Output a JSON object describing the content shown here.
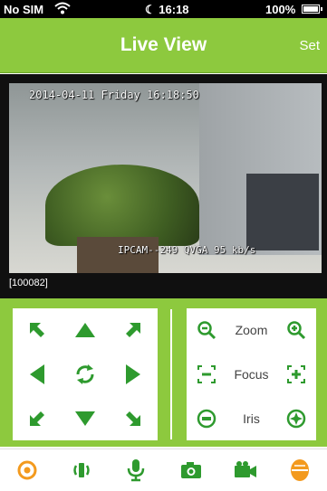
{
  "status_bar": {
    "carrier": "No SIM",
    "time": "16:18",
    "battery": "100%"
  },
  "nav": {
    "title": "Live View",
    "set_label": "Set"
  },
  "video": {
    "osd_date": "2014-04-11 Friday 16:18:50",
    "osd_info": "IPCAM--249 QVGA 95 kb/s",
    "camera_id": "[100082]"
  },
  "lens": {
    "zoom": "Zoom",
    "focus": "Focus",
    "iris": "Iris"
  },
  "colors": {
    "accent": "#8dc93e",
    "icon_green": "#2e9a2e",
    "toolbar_orange": "#f39a1e"
  },
  "toolbar": {
    "items": [
      "record-indicator-icon",
      "audio-icon",
      "microphone-icon",
      "snapshot-icon",
      "video-record-icon",
      "settings-light-icon"
    ]
  }
}
